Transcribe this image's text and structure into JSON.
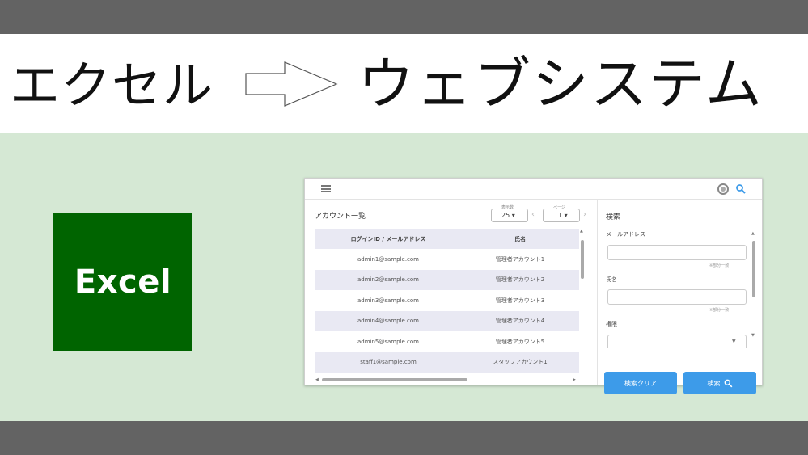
{
  "title": {
    "left_text": "エクセル",
    "right_text": "ウェブシステム"
  },
  "excel_logo": {
    "label": "Excel",
    "color": "#006400"
  },
  "colors": {
    "frame_bar": "#636363",
    "background": "#d5e8d4",
    "accent_button": "#3d9be9"
  },
  "web_app": {
    "header": {
      "icons": [
        "menu-icon",
        "settings-icon",
        "search-icon"
      ]
    },
    "list": {
      "title": "アカウント一覧",
      "per_page_caption": "表示数",
      "per_page_value": "25 ▾",
      "page_caption": "ページ",
      "page_value": "1 ▾",
      "prev": "‹",
      "next": "›",
      "columns": [
        "ログインID / メールアドレス",
        "氏名"
      ],
      "rows": [
        [
          "admin1@sample.com",
          "管理者アカウント1"
        ],
        [
          "admin2@sample.com",
          "管理者アカウント2"
        ],
        [
          "admin3@sample.com",
          "管理者アカウント3"
        ],
        [
          "admin4@sample.com",
          "管理者アカウント4"
        ],
        [
          "admin5@sample.com",
          "管理者アカウント5"
        ],
        [
          "staff1@sample.com",
          "スタッフアカウント1"
        ]
      ]
    },
    "search": {
      "title": "検索",
      "fields": [
        {
          "label": "メールアドレス",
          "hint": "※部分一致"
        },
        {
          "label": "氏名",
          "hint": "※部分一致"
        },
        {
          "label": "権限"
        }
      ],
      "clear_button": "検索クリア",
      "search_button": "検索"
    }
  }
}
